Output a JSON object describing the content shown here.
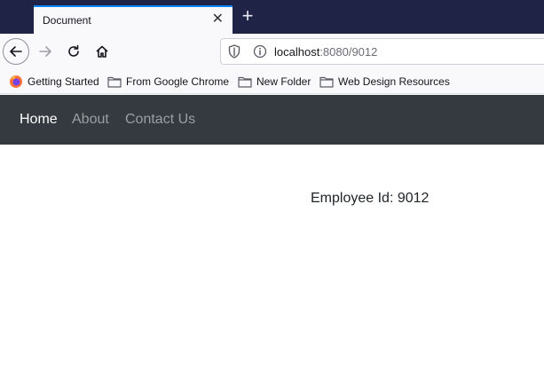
{
  "browser": {
    "tab": {
      "title": "Document",
      "close_glyph": "✕"
    },
    "new_tab_glyph": "+",
    "url": {
      "host": "localhost",
      "rest": ":8080/9012"
    },
    "icons": {
      "back": "back-arrow-icon",
      "forward": "forward-arrow-icon",
      "reload": "reload-icon",
      "home": "home-icon",
      "shield": "shield-icon",
      "info": "info-icon"
    },
    "bookmarks": [
      {
        "label": "Getting Started",
        "icon": "firefox-icon"
      },
      {
        "label": "From Google Chrome",
        "icon": "folder-icon"
      },
      {
        "label": "New Folder",
        "icon": "folder-icon"
      },
      {
        "label": "Web Design Resources",
        "icon": "folder-icon"
      }
    ]
  },
  "page": {
    "nav": [
      {
        "label": "Home",
        "active": true
      },
      {
        "label": "About",
        "active": false
      },
      {
        "label": "Contact Us",
        "active": false
      }
    ],
    "employee_text": "Employee Id: 9012"
  },
  "colors": {
    "tabstrip": "#1f2446",
    "accent": "#0a84ff",
    "site_nav_bg": "#343a40"
  }
}
